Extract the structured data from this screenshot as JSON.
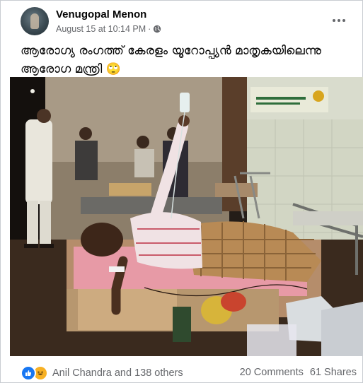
{
  "post": {
    "author": "Venugopal Menon",
    "date": "August 15 at 10:14 PM",
    "separator": "·",
    "privacy_icon": "globe-icon",
    "caption": "ആരോഗ്യ രംഗത്ത് കേരളം യൂറോപ്പ്യൻ മാതൃകയിലെന്നു ആരോഗ മന്ത്രി 🙄",
    "photo_description_icon": "hospital-ward-photo"
  },
  "reactions": {
    "icons": [
      "like-icon",
      "haha-icon"
    ],
    "summary": "Anil Chandra and 138 others"
  },
  "stats": {
    "comments": "20 Comments",
    "shares": "61 Shares"
  },
  "colors": {
    "text_primary": "#050505",
    "text_secondary": "#65676b",
    "like_blue": "#1877f2",
    "haha_yellow": "#f7b125",
    "border": "#c9ccd1"
  }
}
